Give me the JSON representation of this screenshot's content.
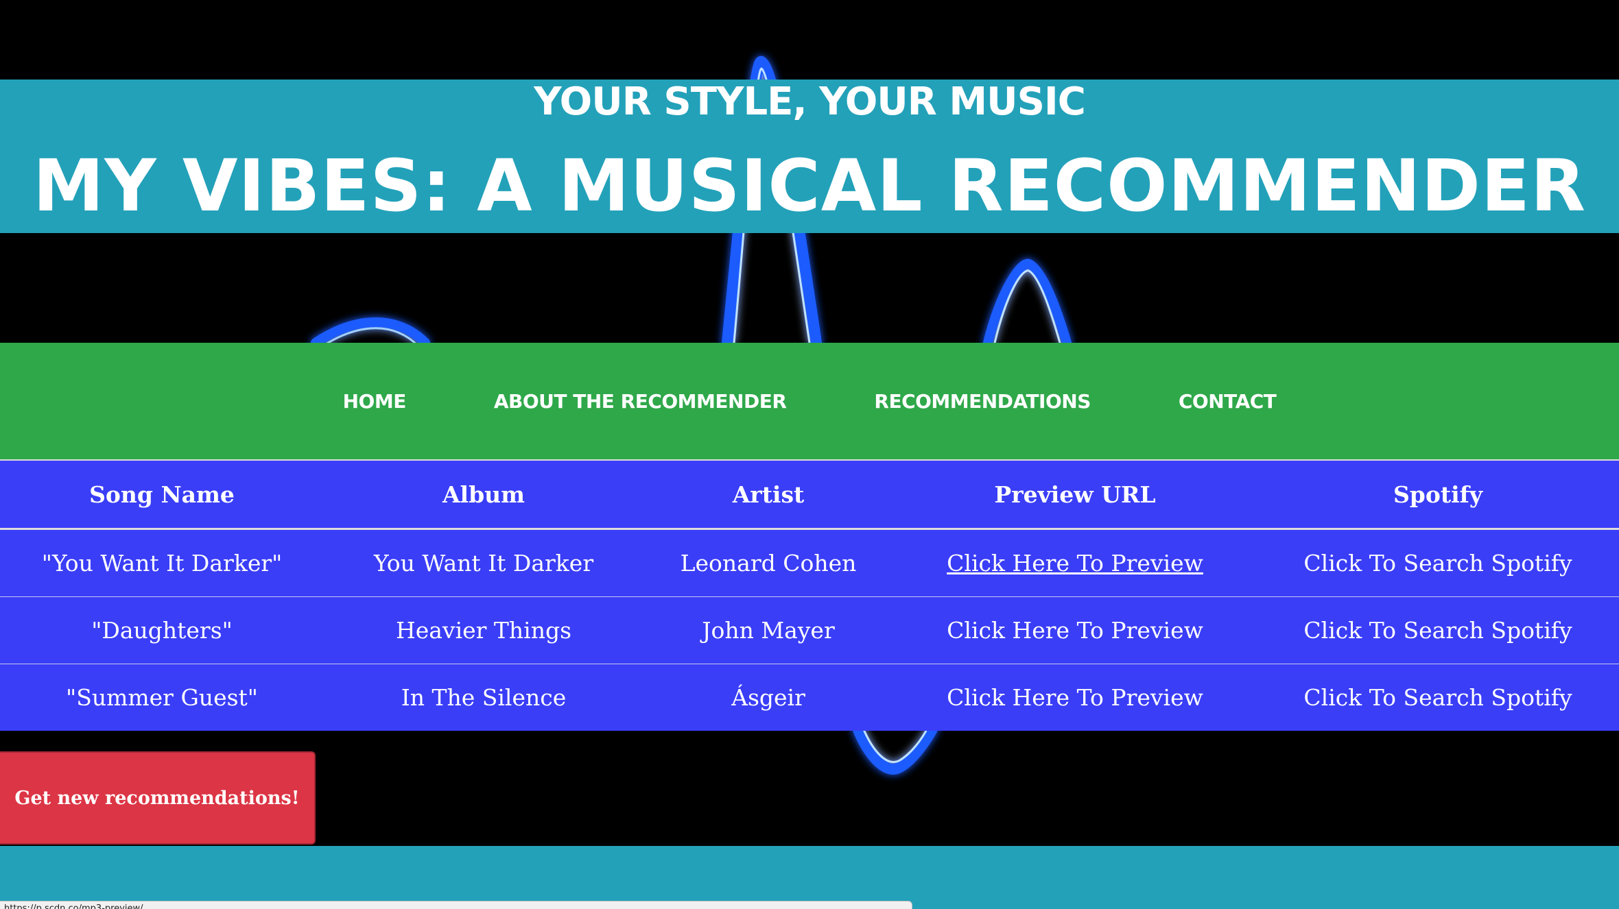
{
  "header": {
    "tagline": "YOUR STYLE, YOUR MUSIC",
    "title": "MY VIBES: A MUSICAL RECOMMENDER"
  },
  "nav": {
    "items": [
      {
        "label": "HOME"
      },
      {
        "label": "ABOUT THE RECOMMENDER"
      },
      {
        "label": "RECOMMENDATIONS"
      },
      {
        "label": "CONTACT"
      }
    ]
  },
  "table": {
    "headers": [
      "Song Name",
      "Album",
      "Artist",
      "Preview URL",
      "Spotify"
    ],
    "rows": [
      {
        "song": "\"You Want It Darker\"",
        "album": "You Want It Darker",
        "artist": "Leonard Cohen",
        "preview": "Click Here To Preview",
        "spotify": "Click To Search Spotify"
      },
      {
        "song": "\"Daughters\"",
        "album": "Heavier Things",
        "artist": "John Mayer",
        "preview": "Click Here To Preview",
        "spotify": "Click To Search Spotify"
      },
      {
        "song": "\"Summer Guest\"",
        "album": "In The Silence",
        "artist": "Ásgeir",
        "preview": "Click Here To Preview",
        "spotify": "Click To Search Spotify"
      }
    ]
  },
  "button": {
    "label": "Get new recommendations!"
  },
  "status_bar": {
    "url": "https://p.scdn.co/mp3-preview/..."
  },
  "colors": {
    "header_band": "#23a1b9",
    "nav_band": "#2fa84a",
    "table_bg": "#3a3ef7",
    "button_bg": "#dc3545",
    "background": "#000000",
    "wave_glow": "#1a5cff"
  }
}
